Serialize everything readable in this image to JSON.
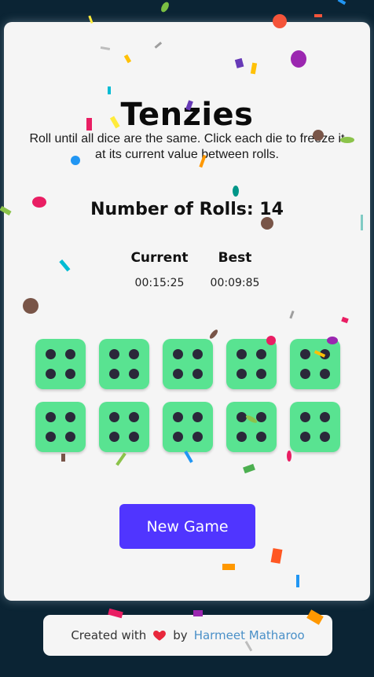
{
  "game": {
    "title": "Tenzies",
    "instructions": "Roll until all dice are the same. Click each die to freeze it at its current value between rolls.",
    "rolls_label": "Number of Rolls: 14",
    "rolls_count": 14
  },
  "timer": {
    "current_label": "Current",
    "best_label": "Best",
    "current_value": "00:15:25",
    "best_value": "00:09:85"
  },
  "dice": [
    {
      "value": 4,
      "held": true
    },
    {
      "value": 4,
      "held": true
    },
    {
      "value": 4,
      "held": true
    },
    {
      "value": 4,
      "held": true
    },
    {
      "value": 4,
      "held": true
    },
    {
      "value": 4,
      "held": true
    },
    {
      "value": 4,
      "held": true
    },
    {
      "value": 4,
      "held": true
    },
    {
      "value": 4,
      "held": true
    },
    {
      "value": 4,
      "held": true
    }
  ],
  "colors": {
    "held_die": "#59e391",
    "pip": "#2b283a",
    "button": "#5035ff",
    "background": "#0b2434",
    "link": "#4a90c8"
  },
  "new_game_label": "New Game",
  "footer": {
    "prefix": "Created with",
    "icon": "heart-icon",
    "by": "by",
    "author": "Harmeet Matharoo"
  }
}
